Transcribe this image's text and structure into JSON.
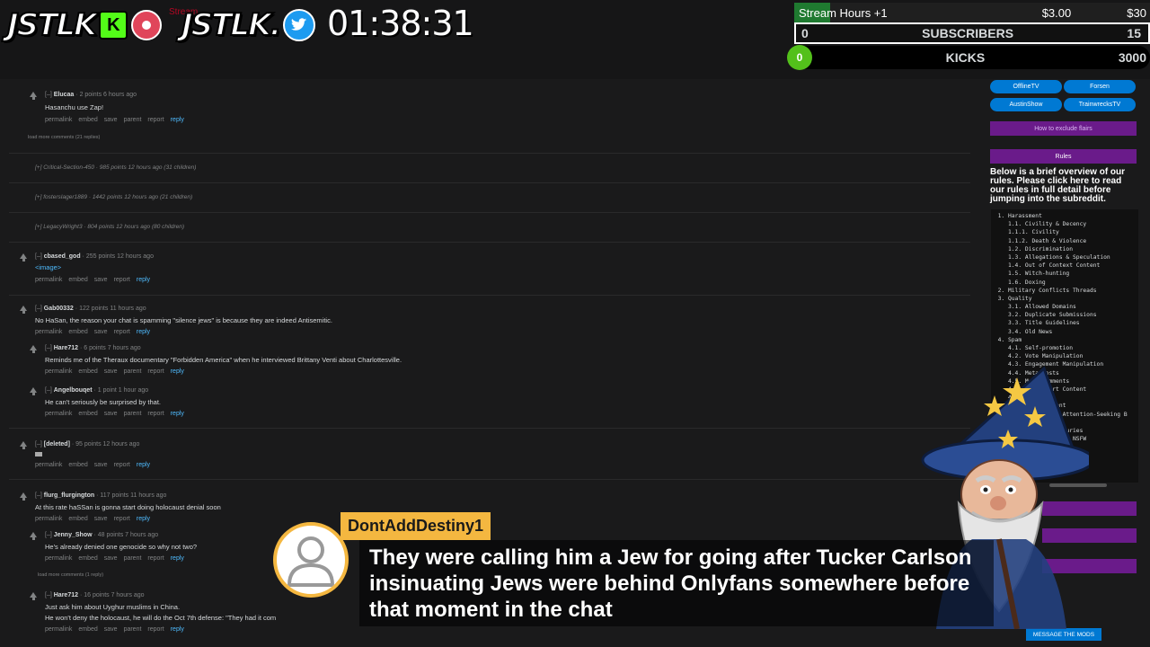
{
  "overlay": {
    "brand1": "JSTLK",
    "brand2": "JSTLK.",
    "kick_letter": "K",
    "timer": "01:38:31",
    "stream_ghost_text": "Stream",
    "stats": {
      "hours_label": "Stream Hours +1",
      "hours_amount": "$3.00",
      "hours_goal": "$30",
      "hours_progress": 0.1,
      "subs_current": "0",
      "subs_label": "SUBSCRIBERS",
      "subs_goal": "15",
      "kicks_current": "0",
      "kicks_label": "KICKS",
      "kicks_goal": "3000"
    }
  },
  "comments": {
    "c1": {
      "user": "Elucaa",
      "meta": "2 points 6 hours ago",
      "body": "Hasanchu use Zap!",
      "actions": [
        "permalink",
        "embed",
        "save",
        "parent",
        "report"
      ],
      "reply": "reply"
    },
    "load_more_1": "load more comments (21 replies)",
    "collapsed1": {
      "toggle": "[+]",
      "user": "Critical-Section-450",
      "meta": "985 points 12 hours ago",
      "children": "(31 children)"
    },
    "collapsed2": {
      "toggle": "[+]",
      "user": "fostersIager1889",
      "meta": "1442 points 12 hours ago",
      "children": "(21 children)"
    },
    "collapsed3": {
      "toggle": "[+]",
      "user": "LegacyWright3",
      "meta": "804 points 12 hours ago",
      "children": "(80 children)"
    },
    "c2": {
      "user": "cbased_god",
      "meta": "255 points 12 hours ago",
      "body": "<image>",
      "actions": [
        "permalink",
        "embed",
        "save",
        "report"
      ],
      "reply": "reply"
    },
    "c3": {
      "user": "Gab00332",
      "meta": "122 points 11 hours ago",
      "body": "No HaSan, the reason your chat is spamming \"silence jews\" is because they are indeed Antisemitic.",
      "actions": [
        "permalink",
        "embed",
        "save",
        "report"
      ],
      "reply": "reply"
    },
    "c4": {
      "user": "Hare712",
      "meta": "6 points 7 hours ago",
      "body": "Reminds me of the Theraux documentary \"Forbidden America\" when he interviewed Brittany Venti about Charlottesville.",
      "actions": [
        "permalink",
        "embed",
        "save",
        "parent",
        "report"
      ],
      "reply": "reply"
    },
    "c5": {
      "user": "Angelbouqet",
      "meta": "1 point 1 hour ago",
      "body": "He can't seriously be surprised by that.",
      "actions": [
        "permalink",
        "embed",
        "save",
        "parent",
        "report"
      ],
      "reply": "reply"
    },
    "c6": {
      "user": "[deleted]",
      "meta": "95 points 12 hours ago",
      "body": "",
      "actions": [
        "permalink",
        "embed",
        "save",
        "report"
      ],
      "reply": "reply"
    },
    "c7": {
      "user": "flurg_flurgington",
      "meta": "117 points 11 hours ago",
      "body": "At this rate haSSan is gonna start doing holocaust denial soon",
      "actions": [
        "permalink",
        "embed",
        "save",
        "report"
      ],
      "reply": "reply"
    },
    "c8": {
      "user": "Jenny_Show",
      "meta": "48 points 7 hours ago",
      "body": "He's already denied one genocide so why not two?",
      "actions": [
        "permalink",
        "embed",
        "save",
        "parent",
        "report"
      ],
      "reply": "reply"
    },
    "load_more_2": "load more comments (1 reply)",
    "c9": {
      "user": "Hare712",
      "meta": "16 points 7 hours ago",
      "body": "Just ask him about Uyghur muslims in China.",
      "body2": "He won't deny the holocaust, he will do the Oct 7th defense: \"They had it com",
      "actions": [
        "permalink",
        "embed",
        "save",
        "parent",
        "report"
      ],
      "reply": "reply"
    },
    "toggle_open": "[–]"
  },
  "sidebar": {
    "pills": [
      "OfflineTV",
      "Forsen",
      "AustinShow",
      "TrainwrecksTV"
    ],
    "exclude_flairs": "How to exclude flairs",
    "rules_title": "Rules",
    "rules_intro": "Below is a brief overview of our rules. Please click here to read our rules in full detail before jumping into the subreddit.",
    "rules": [
      "1. Harassment",
      "   1.1. Civility & Decency",
      "   1.1.1. Civility",
      "   1.1.2. Death & Violence",
      "   1.2. Discrimination",
      "   1.3. Allegations & Speculation",
      "   1.4. Out of Context Content",
      "   1.5. Witch-hunting",
      "   1.6. Doxing",
      "2. Military Conflicts Threads",
      "3. Quality",
      "   3.1. Allowed Domains",
      "   3.2. Duplicate Submissions",
      "   3.3. Title Guidelines",
      "   3.4. Old News",
      "4. Spam",
      "   4.1. Self-promotion",
      "   4.2. Vote Manipulation",
      "   4.3. Engagement Manipulation",
      "   4.4. Meta Posts",
      "   4.5. Meta Comments",
      "   4.6. Low-effort Content",
      "   4.7. Rumors",
      "   4.8. NSFW Content",
      "   4.9. Gratifying Attention-Seeking B",
      "   5. Betting",
      "   5.1. Deaths & Injuries",
      "   5.2. Nonconsensual NSFW"
    ],
    "message_mods": "MESSAGE THE MODS"
  },
  "chat": {
    "username": "DontAddDestiny1",
    "message": "They were calling him a Jew for going after Tucker Carlson insinuating Jews were behind Onlyfans somewhere before that moment in the chat"
  },
  "colors": {
    "background": "#1a1a1b",
    "link_blue": "#4fbcff",
    "sidebar_button": "#0079d3",
    "purple": "#6a1b8a",
    "chat_name_bg": "#f4b740",
    "kick_green": "#53fc18"
  },
  "icons": [
    "upvote-arrow-icon",
    "twitter-icon",
    "kick-icon",
    "record-icon",
    "user-avatar-icon",
    "wizard-mascot"
  ]
}
